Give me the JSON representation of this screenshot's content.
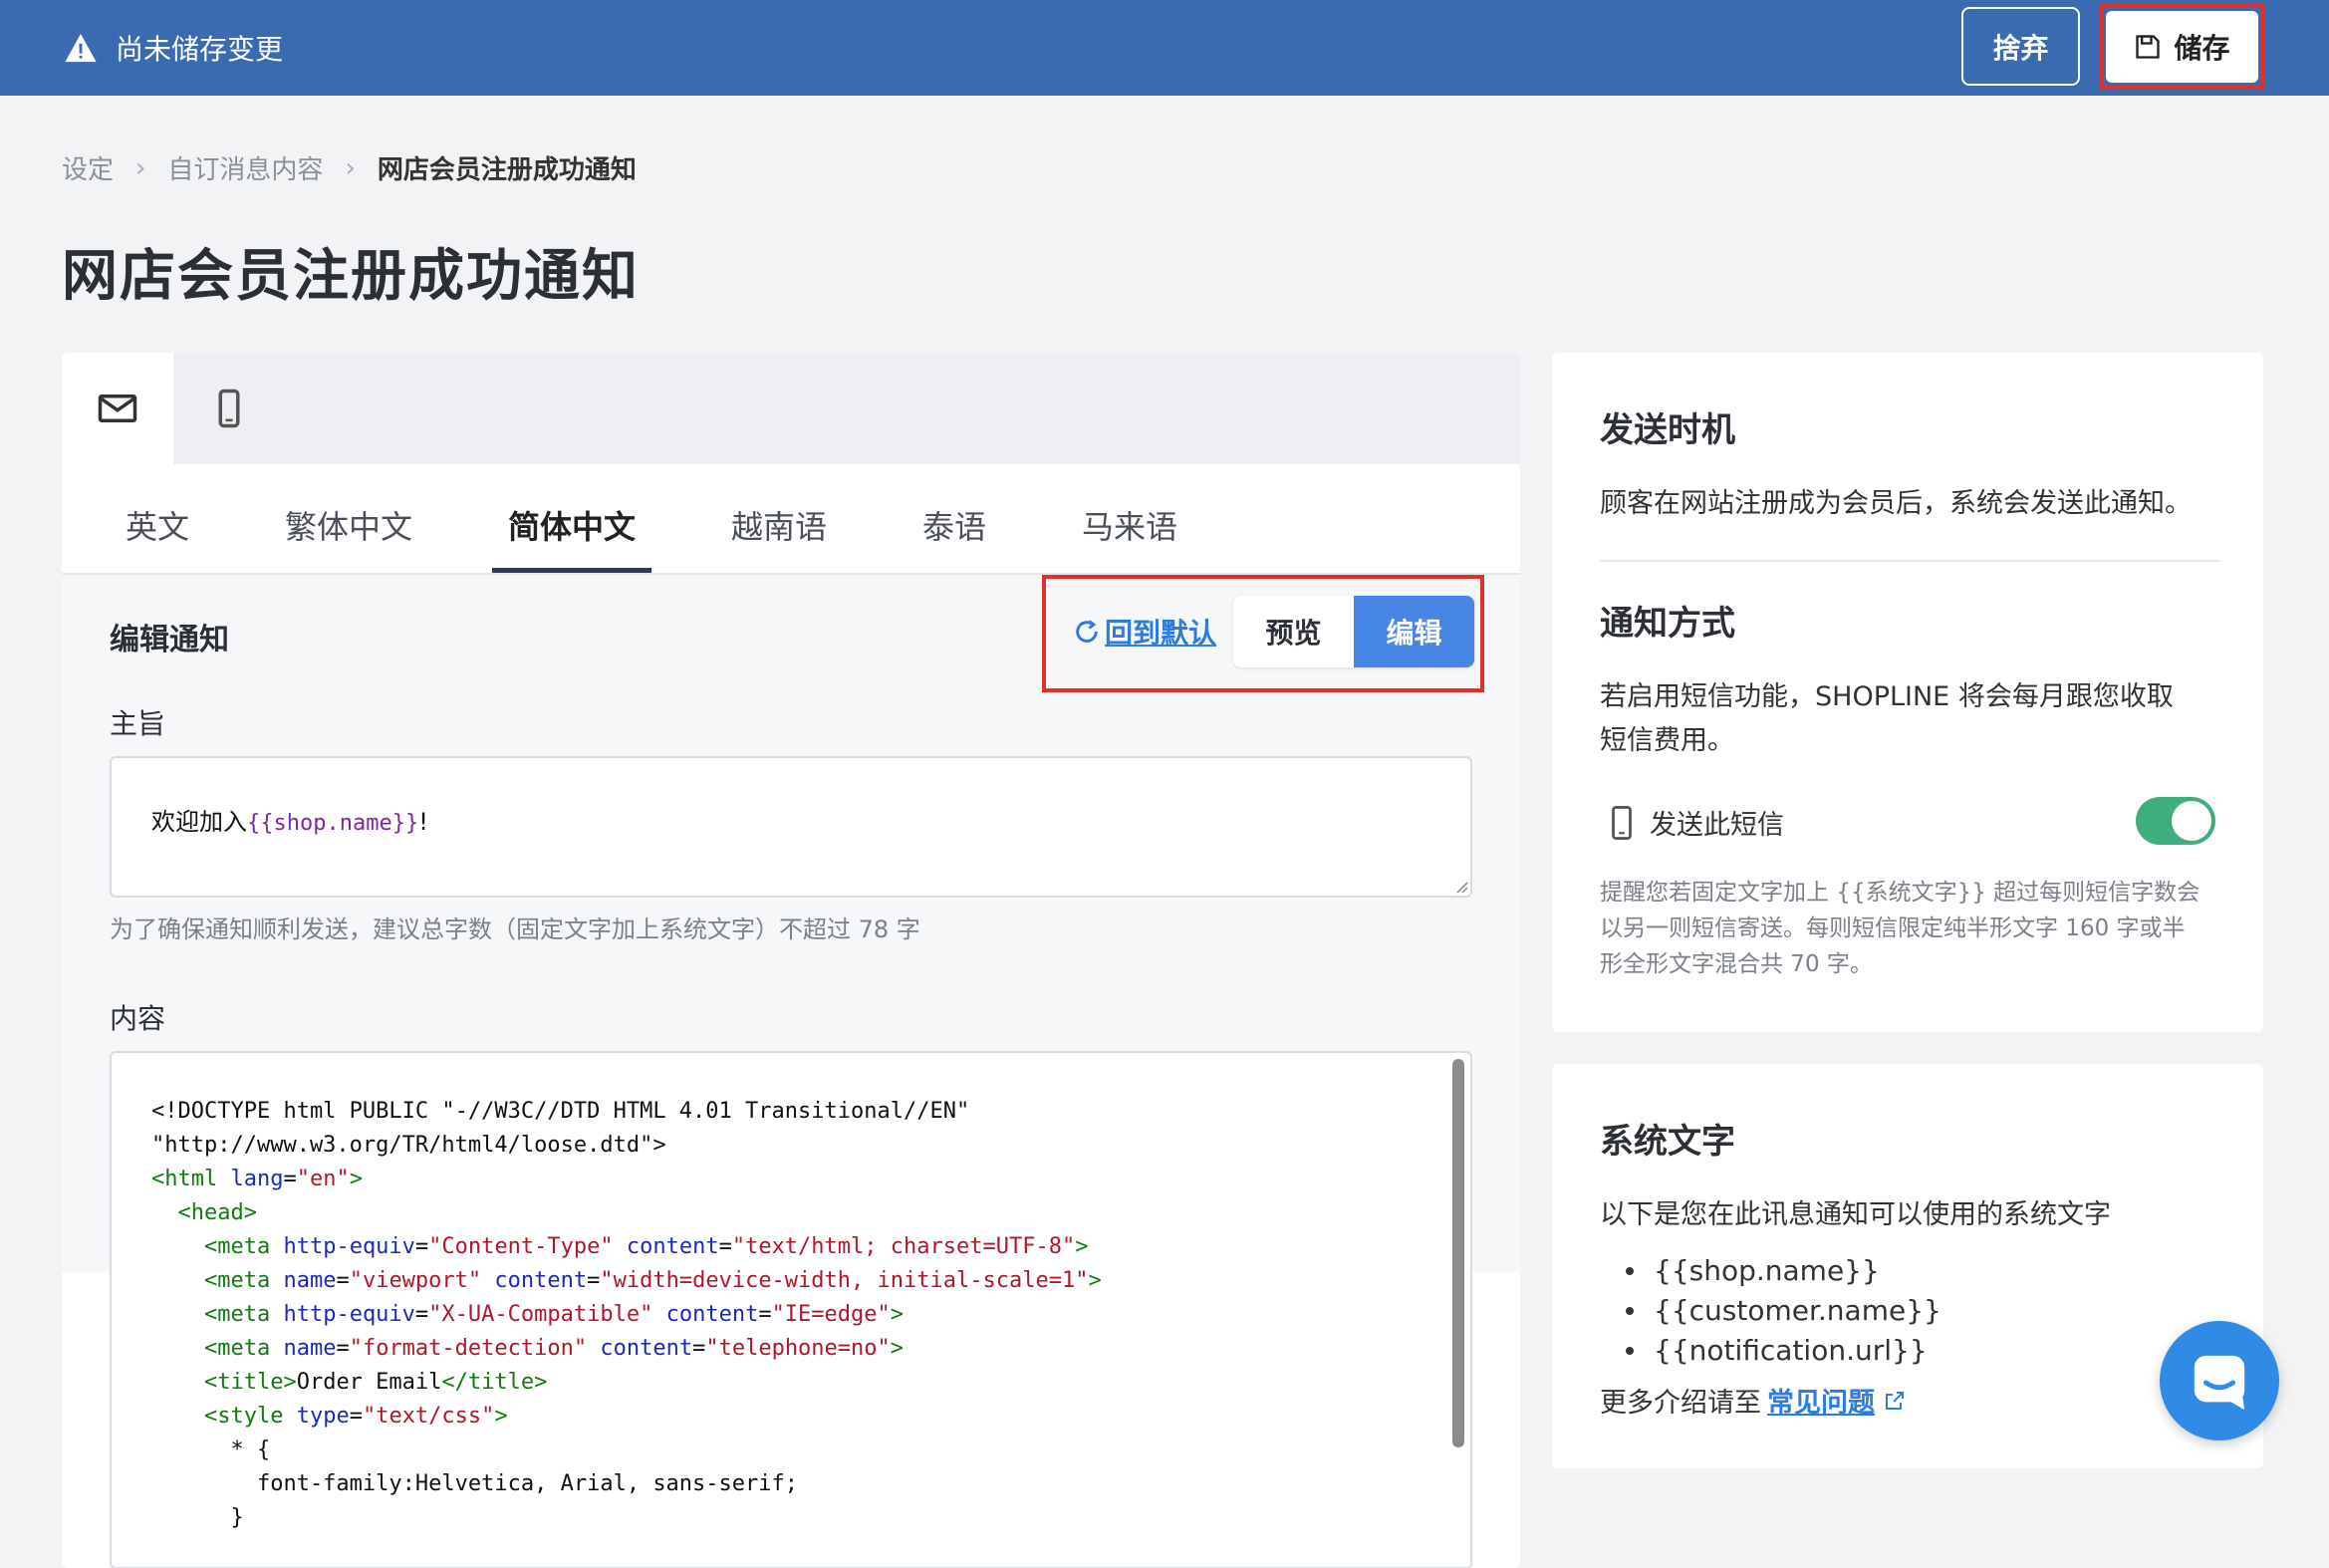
{
  "topbar": {
    "unsaved_text": "尚未储存变更",
    "discard_label": "捨弃",
    "save_label": "储存"
  },
  "breadcrumb": {
    "items": [
      "设定",
      "自订消息内容",
      "网店会员注册成功通知"
    ]
  },
  "page_title": "网店会员注册成功通知",
  "channels": [
    {
      "icon": "mail-icon",
      "active": true
    },
    {
      "icon": "mobile-icon",
      "active": false
    }
  ],
  "lang_tabs": [
    {
      "label": "英文"
    },
    {
      "label": "繁体中文"
    },
    {
      "label": "简体中文",
      "active": true
    },
    {
      "label": "越南语"
    },
    {
      "label": "泰语"
    },
    {
      "label": "马来语"
    }
  ],
  "editor": {
    "title": "编辑通知",
    "reset_label": "回到默认",
    "preview_label": "预览",
    "edit_label": "编辑",
    "subject_label": "主旨",
    "subject_prefix": "欢迎加入",
    "subject_var": "{{shop.name}}",
    "subject_suffix": "!",
    "subject_hint": "为了确保通知顺利发送，建议总字数（固定文字加上系统文字）不超过 78 字",
    "content_label": "内容"
  },
  "send_timing": {
    "title": "发送时机",
    "text": "顾客在网站注册成为会员后，系统会发送此通知。"
  },
  "notify_method": {
    "title": "通知方式",
    "text_line1": "若启用短信功能，SHOPLINE 将会每月跟您收取",
    "text_line2": "短信费用。",
    "sms_label": "发送此短信",
    "sms_enabled": true,
    "note_line1": "提醒您若固定文字加上 {{系统文字}} 超过每则短信字数会",
    "note_line2": "以另一则短信寄送。每则短信限定纯半形文字 160 字或半",
    "note_line3": "形全形文字混合共 70 字。"
  },
  "system_text": {
    "title": "系统文字",
    "intro": "以下是您在此讯息通知可以使用的系统文字",
    "vars": [
      "{{shop.name}}",
      "{{customer.name}}",
      "{{notification.url}}"
    ],
    "more_prefix": "更多介绍请至",
    "more_link": "常见问题"
  },
  "colors": {
    "topbar": "#3a6ab0",
    "highlight": "#e0302a",
    "accent": "#4886e6",
    "link": "#2f7be0",
    "toggle_on": "#3fae7e"
  }
}
